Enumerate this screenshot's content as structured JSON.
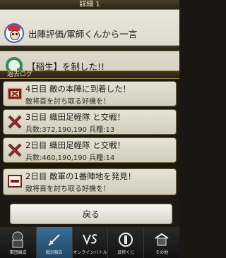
{
  "header": {
    "title": "詳細 1"
  },
  "top_rows": [
    {
      "text": "出陣評価/軍師くんから一言",
      "icon": "advisor-avatar-icon"
    },
    {
      "text": "【稲生】を制した!!",
      "icon": "green-ring-icon"
    }
  ],
  "section": {
    "label": "過去ログ"
  },
  "logs": [
    {
      "title": "4日目 敵の本陣に到着した！",
      "detail": "敵将首を討ち取る好機を！",
      "icon": "flag-icon"
    },
    {
      "title": "3日目 織田足軽隊 と交戦！",
      "detail": "兵数:372,190,190 兵糧:13",
      "icon": "crossed-swords-icon"
    },
    {
      "title": "2日目 織田足軽隊 と交戦！",
      "detail": "兵数:460,190,190 兵糧:14",
      "icon": "crossed-swords-icon"
    },
    {
      "title": "2日目 敵軍の1番陣地を発見！",
      "detail": "敵将首を討ち取る好機を！",
      "icon": "banner-icon"
    }
  ],
  "actions": {
    "back": "戻る"
  },
  "tabs": [
    {
      "label": "軍団編成",
      "icon": "armor-icon"
    },
    {
      "label": "戦況報告",
      "icon": "sword-icon"
    },
    {
      "label": "オンラインバトル",
      "icon": "vs-icon"
    },
    {
      "label": "武将くじ",
      "icon": "lottery-icon"
    },
    {
      "label": "その他",
      "icon": "other-icon"
    }
  ]
}
